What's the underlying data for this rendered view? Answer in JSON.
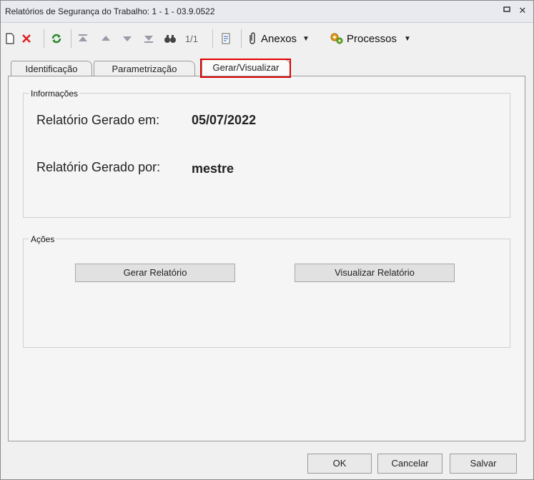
{
  "window": {
    "title": "Relatórios de Segurança do Trabalho: 1 - 1 - 03.9.0522"
  },
  "toolbar": {
    "record_position": "1/1",
    "attachments_label": "Anexos",
    "processes_label": "Processos"
  },
  "tabs": [
    {
      "label": "Identificação"
    },
    {
      "label": "Parametrização"
    },
    {
      "label": "Gerar/Visualizar"
    }
  ],
  "info_group": {
    "title": "Informações",
    "generated_on_label": "Relatório Gerado em:",
    "generated_on_value": "05/07/2022",
    "generated_by_label": "Relatório Gerado por:",
    "generated_by_value": "mestre"
  },
  "actions_group": {
    "title": "Ações",
    "generate_label": "Gerar Relatório",
    "view_label": "Visualizar Relatório"
  },
  "footer": {
    "ok_label": "OK",
    "cancel_label": "Cancelar",
    "save_label": "Salvar"
  },
  "colors": {
    "active_tab_highlight": "#e00000",
    "delete_icon": "#e02020",
    "refresh_icon": "#2a8a2a"
  }
}
